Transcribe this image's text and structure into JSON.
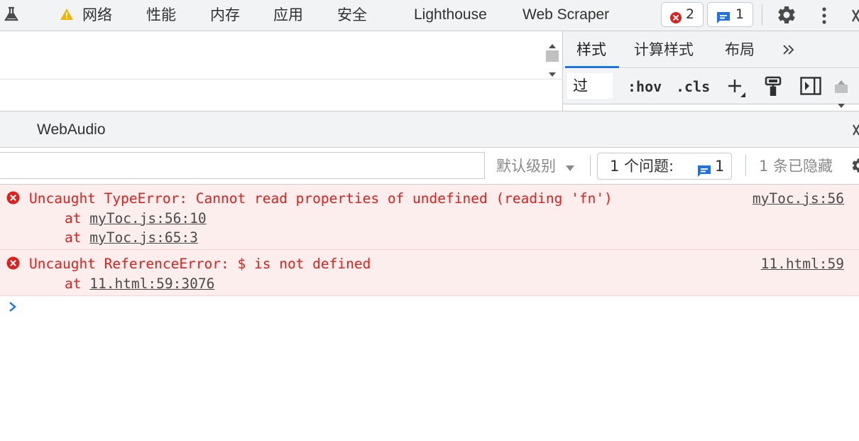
{
  "top_tabs": [
    "网络",
    "性能",
    "内存",
    "应用",
    "安全",
    "Lighthouse",
    "Web Scraper"
  ],
  "badges": {
    "errors": "2",
    "messages": "1"
  },
  "sidebar": {
    "tabs": [
      "样式",
      "计算样式",
      "布局"
    ],
    "filter_value": "过",
    "hov": ":hov",
    "cls": ".cls"
  },
  "drawer": {
    "tab": "WebAudio"
  },
  "console_toolbar": {
    "level": "默认级别",
    "issues_label": "1 个问题:",
    "issues_count": "1",
    "hidden": "1 条已隐藏"
  },
  "messages": [
    {
      "text": "Uncaught TypeError: Cannot read properties of undefined (reading 'fn')",
      "source": "myToc.js:56",
      "stack": [
        {
          "prefix": "at ",
          "link": "myToc.js:56:10"
        },
        {
          "prefix": "at ",
          "link": "myToc.js:65:3"
        }
      ]
    },
    {
      "text": "Uncaught ReferenceError: $ is not defined",
      "source": "11.html:59",
      "stack": [
        {
          "prefix": "at ",
          "link": "11.html:59:3076"
        }
      ]
    }
  ],
  "colors": {
    "error_text": "#e0201b",
    "error_bg": "#fdeeee",
    "accent": "#1a73e8"
  }
}
